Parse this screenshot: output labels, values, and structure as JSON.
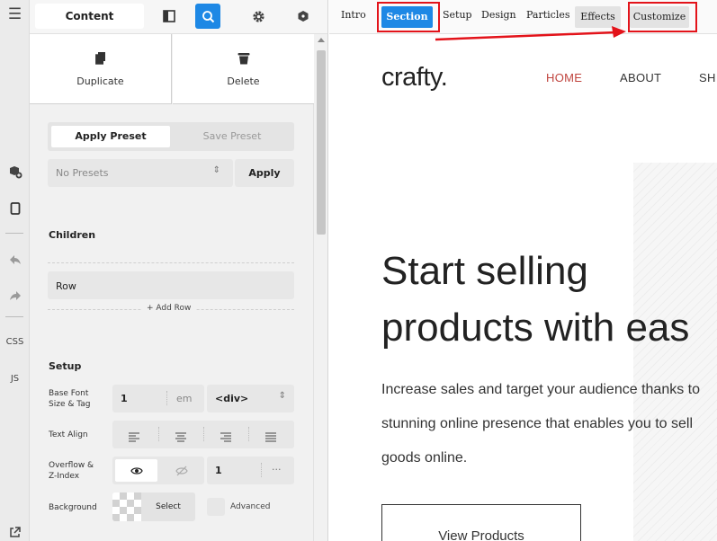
{
  "rail": {
    "items": [
      {
        "name": "hamburger-icon",
        "glyph": "☰"
      },
      {
        "name": "add-element-icon",
        "glyph": ""
      },
      {
        "name": "device-icon",
        "glyph": ""
      },
      {
        "name": "undo-icon",
        "glyph": ""
      },
      {
        "name": "redo-icon",
        "glyph": ""
      },
      {
        "name": "css-label",
        "text": "CSS"
      },
      {
        "name": "js-label",
        "text": "JS"
      },
      {
        "name": "external-icon",
        "glyph": ""
      }
    ],
    "css": "CSS",
    "js": "JS"
  },
  "panel": {
    "content_tab": "Content",
    "duplicate": "Duplicate",
    "delete": "Delete",
    "apply_preset": "Apply Preset",
    "save_preset": "Save Preset",
    "no_presets": "No Presets",
    "apply": "Apply",
    "children_heading": "Children",
    "row_label": "Row",
    "add_row": "+ Add Row",
    "setup_heading": "Setup",
    "base_font_label": "Base Font Size & Tag",
    "base_font_value": "1",
    "base_font_unit": "em",
    "tag_value": "<div>",
    "text_align_label": "Text Align",
    "overflow_label": "Overflow & Z-Index",
    "zindex_value": "1",
    "zindex_more": "···",
    "background_label": "Background",
    "select_label": "Select",
    "advanced_label": "Advanced"
  },
  "toolbar": {
    "tabs": [
      "Intro",
      "Section",
      "Setup",
      "Design",
      "Particles",
      "Effects",
      "Customize"
    ],
    "active": "Section"
  },
  "site": {
    "logo": "crafty.",
    "nav": [
      "HOME",
      "ABOUT",
      "SH"
    ],
    "hero_line1": "Start selling",
    "hero_line2": "products with eas",
    "body1": "Increase sales and target your audience thanks to",
    "body2": "stunning online presence that enables you to sell",
    "body3": "goods online.",
    "button": "View Products"
  },
  "colors": {
    "accent": "#1e88e5",
    "highlight": "#e3131a",
    "nav_active": "#c0453f"
  }
}
